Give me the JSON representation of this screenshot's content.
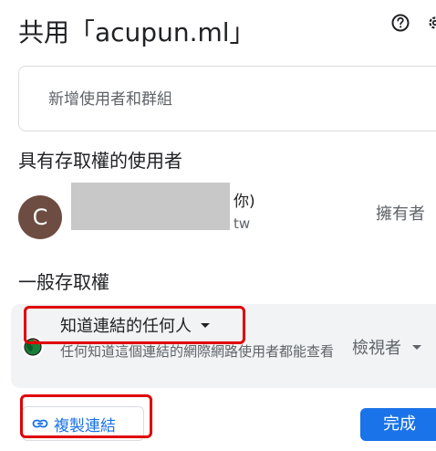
{
  "dialog": {
    "title": "共用「acupun.ml」",
    "add_people_placeholder": "新增使用者和群組"
  },
  "people_section": {
    "heading": "具有存取權的使用者",
    "users": [
      {
        "avatar_letter": "C",
        "avatar_color": "#6d4c41",
        "name_visible_suffix": "你)",
        "email_visible_prefix": "@",
        "email_visible_suffix": "tw",
        "role": "擁有者"
      }
    ]
  },
  "general_access": {
    "heading": "一般存取權",
    "access_level": "知道連結的任何人",
    "description": "任何知道這個連結的網際網路使用者都能查看",
    "role": "檢視者"
  },
  "footer": {
    "copy_link_label": "複製連結",
    "done_label": "完成"
  },
  "icons": {
    "help": "help-icon",
    "settings": "settings-icon",
    "globe": "globe-icon",
    "link": "link-icon"
  },
  "colors": {
    "primary": "#1a73e8",
    "highlight": "#e00000",
    "card_bg": "#f1f3f4",
    "globe_green": "#188038"
  }
}
